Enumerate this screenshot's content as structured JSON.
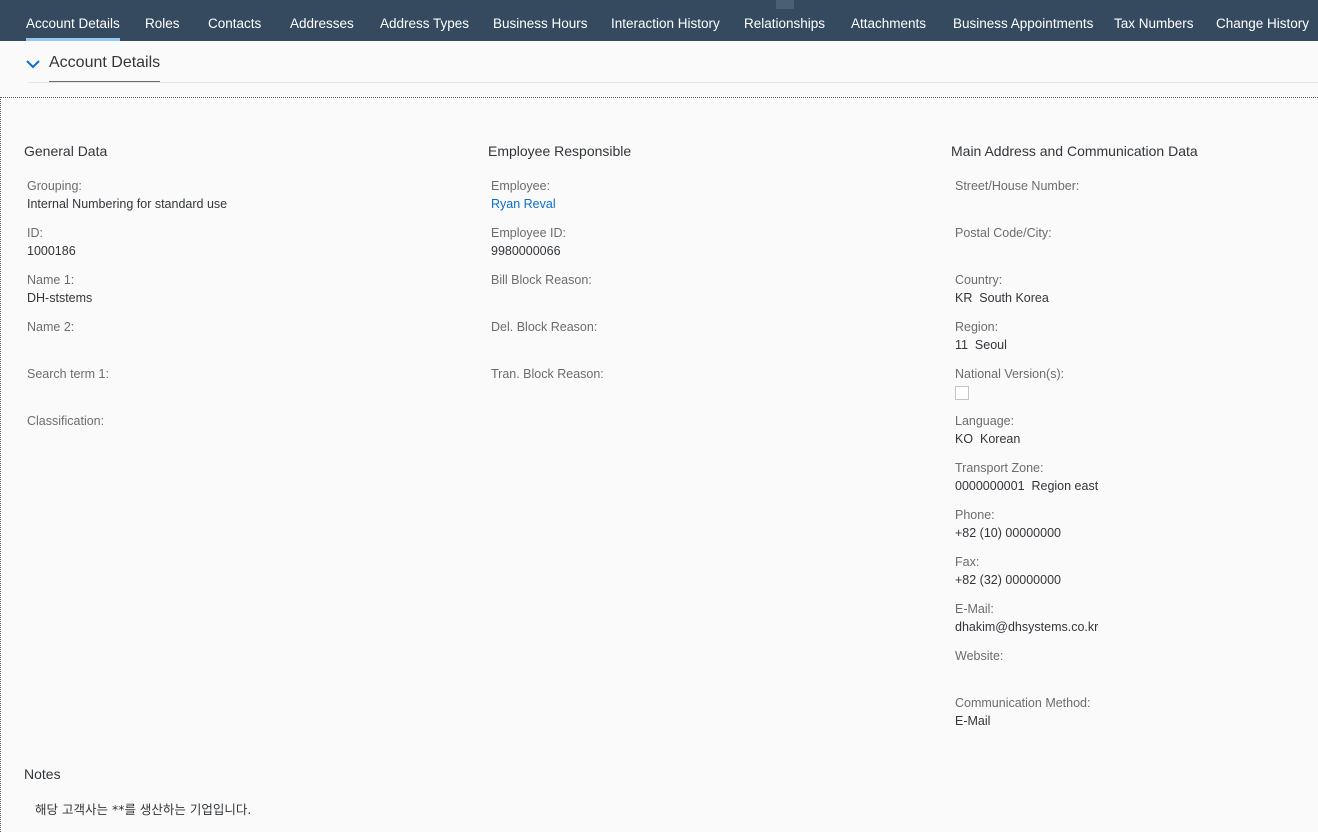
{
  "tabs": [
    {
      "label": "Account Details",
      "active": true
    },
    {
      "label": "Roles"
    },
    {
      "label": "Contacts"
    },
    {
      "label": "Addresses"
    },
    {
      "label": "Address Types"
    },
    {
      "label": "Business Hours"
    },
    {
      "label": "Interaction History"
    },
    {
      "label": "Relationships"
    },
    {
      "label": "Attachments"
    },
    {
      "label": "Business Appointments"
    },
    {
      "label": "Tax Numbers"
    },
    {
      "label": "Change History"
    }
  ],
  "section": {
    "title": "Account Details",
    "toggle_icon": "chevron-down-icon"
  },
  "general_data": {
    "title": "General Data",
    "grouping_label": "Grouping:",
    "grouping_value": "Internal Numbering for standard use",
    "id_label": "ID:",
    "id_value": "1000186",
    "name1_label": "Name 1:",
    "name1_value": "DH-ststems",
    "name2_label": "Name 2:",
    "search_term_label": "Search term 1:",
    "classification_label": "Classification:"
  },
  "employee_responsible": {
    "title": "Employee Responsible",
    "employee_label": "Employee:",
    "employee_value": "Ryan Reval",
    "employee_id_label": "Employee ID:",
    "employee_id_value": "9980000066",
    "bill_block_label": "Bill Block Reason:",
    "del_block_label": "Del. Block Reason:",
    "tran_block_label": "Tran. Block Reason:"
  },
  "main_address": {
    "title": "Main Address and Communication Data",
    "street_label": "Street/House Number:",
    "postal_label": "Postal Code/City:",
    "country_label": "Country:",
    "country_value": "KR  South Korea",
    "region_label": "Region:",
    "region_value": "11  Seoul",
    "national_version_label": "National Version(s):",
    "national_version_checked": false,
    "language_label": "Language:",
    "language_value": "KO  Korean",
    "transport_zone_label": "Transport Zone:",
    "transport_zone_value": "0000000001  Region east",
    "phone_label": "Phone:",
    "phone_value": "+82 (10) 00000000",
    "fax_label": "Fax:",
    "fax_value": "+82 (32) 00000000",
    "email_label": "E-Mail:",
    "email_value": "dhakim@dhsystems.co.kr",
    "website_label": "Website:",
    "comm_method_label": "Communication Method:",
    "comm_method_value": "E-Mail"
  },
  "notes": {
    "title": "Notes",
    "text": "해당 고객사는 **를 생산하는 기업입니다."
  },
  "colors": {
    "tabbar_bg": "#354a5f",
    "active_tab_underline": "#91c8f6",
    "link": "#0a6ed1",
    "label": "#6a6d70",
    "text": "#32363a",
    "page_bg": "#fafafa"
  }
}
